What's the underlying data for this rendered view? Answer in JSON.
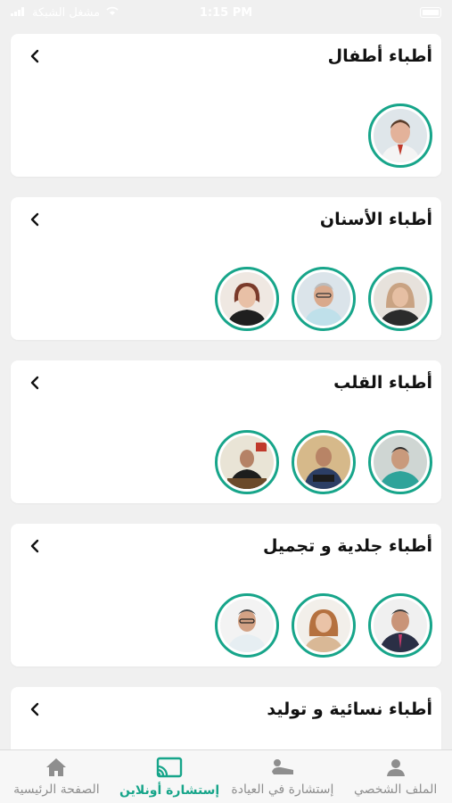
{
  "status_bar": {
    "carrier": "مشغل الشبكة",
    "time": "1:15 PM"
  },
  "sections": [
    {
      "title": "أطباء أطفال",
      "doctors": 1
    },
    {
      "title": "أطباء الأسنان",
      "doctors": 3
    },
    {
      "title": "أطباء القلب",
      "doctors": 3
    },
    {
      "title": "أطباء جلدية و تجميل",
      "doctors": 3
    },
    {
      "title": "أطباء نسائية و توليد",
      "doctors": 0
    }
  ],
  "tabbar": {
    "tabs": [
      {
        "label": "الملف الشخصي",
        "icon": "person-icon"
      },
      {
        "label": "إستشارة في العيادة",
        "icon": "clinic-icon"
      },
      {
        "label": "إستشارة أونلاين",
        "icon": "cast-icon"
      },
      {
        "label": "الصفحة الرئيسية",
        "icon": "home-icon"
      }
    ],
    "active_index": 2
  },
  "colors": {
    "accent": "#17a58a",
    "inactive": "#8e8e8e"
  }
}
